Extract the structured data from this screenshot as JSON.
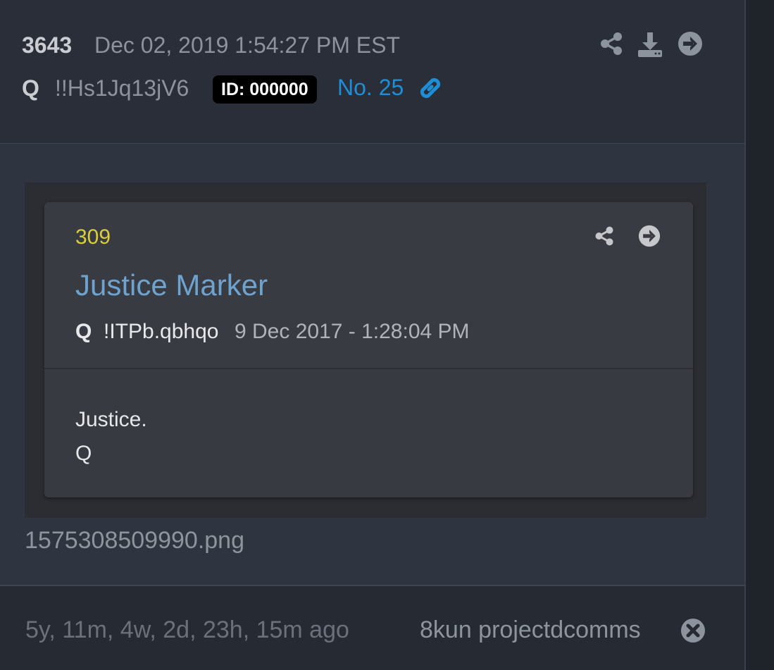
{
  "post": {
    "number": "3643",
    "date": "Dec 02, 2019 1:54:27 PM EST",
    "author": "Q",
    "tripcode": "!!Hs1Jq13jV6",
    "id_badge": "ID: 000000",
    "post_no": "No. 25"
  },
  "header_icons": [
    "share-icon",
    "download-icon",
    "arrow-right-circle-icon"
  ],
  "embedded_post": {
    "number": "309",
    "title": "Justice Marker",
    "author": "Q",
    "tripcode": "!ITPb.qbhqo",
    "date": "9 Dec 2017 - 1:28:04 PM",
    "text_line1": "Justice.",
    "text_line2": "Q",
    "icons": [
      "share-icon",
      "arrow-right-circle-icon"
    ]
  },
  "attachment": {
    "filename": "1575308509990.png"
  },
  "footer": {
    "ago": "5y, 11m, 4w, 2d, 23h, 15m ago",
    "source": "8kun projectdcomms"
  },
  "colors": {
    "accent_blue": "#1e8fd6",
    "embed_number_yellow": "#d8cf3a",
    "embed_title_blue": "#6fa3cf"
  }
}
